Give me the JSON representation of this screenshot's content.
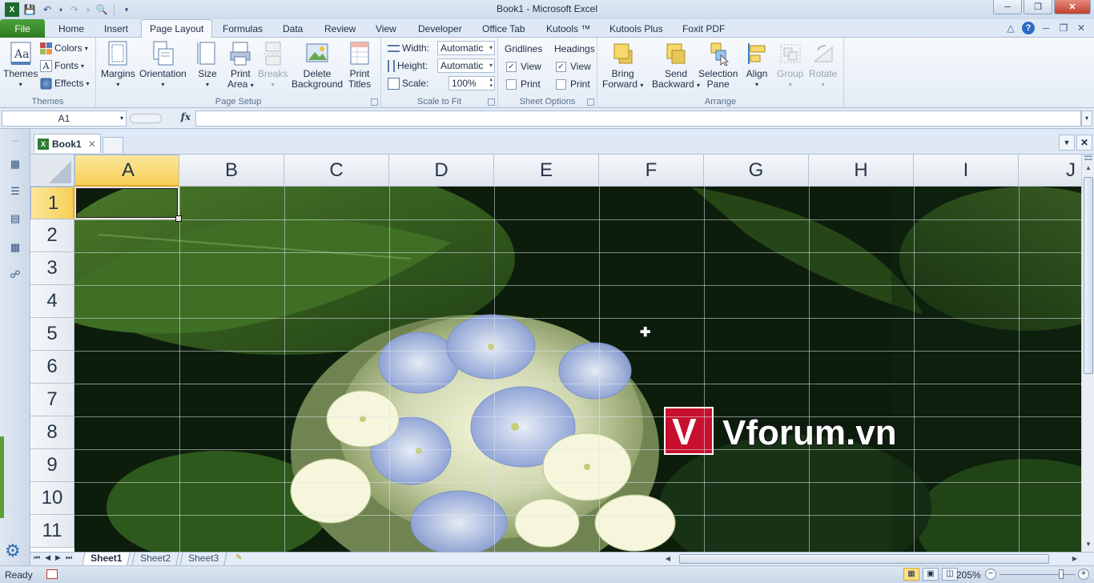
{
  "window": {
    "title": "Book1 - Microsoft Excel"
  },
  "qat": {
    "icons": [
      "save-icon",
      "undo-icon",
      "redo-icon",
      "print-preview-icon",
      "customize-icon"
    ]
  },
  "ribbon_tabs": {
    "file": "File",
    "tabs": [
      "Home",
      "Insert",
      "Page Layout",
      "Formulas",
      "Data",
      "Review",
      "View",
      "Developer",
      "Office Tab",
      "Kutools ™",
      "Kutools Plus",
      "Foxit PDF"
    ],
    "active": "Page Layout"
  },
  "ribbon": {
    "themes": {
      "label": "Themes",
      "themes_btn": "Themes",
      "colors": "Colors",
      "fonts": "Fonts",
      "effects": "Effects"
    },
    "page_setup": {
      "label": "Page Setup",
      "margins": "Margins",
      "orientation": "Orientation",
      "size": "Size",
      "print_area_1": "Print",
      "print_area_2": "Area",
      "breaks": "Breaks",
      "delete_bg_1": "Delete",
      "delete_bg_2": "Background",
      "print_titles_1": "Print",
      "print_titles_2": "Titles"
    },
    "scale_to_fit": {
      "label": "Scale to Fit",
      "width_label": "Width:",
      "width_value": "Automatic",
      "height_label": "Height:",
      "height_value": "Automatic",
      "scale_label": "Scale:",
      "scale_value": "100%"
    },
    "sheet_options": {
      "label": "Sheet Options",
      "gridlines": "Gridlines",
      "headings": "Headings",
      "view": "View",
      "print": "Print",
      "gridlines_view": true,
      "gridlines_print": false,
      "headings_view": true,
      "headings_print": false
    },
    "arrange": {
      "label": "Arrange",
      "bring_1": "Bring",
      "bring_2": "Forward",
      "send_1": "Send",
      "send_2": "Backward",
      "selection_1": "Selection",
      "selection_2": "Pane",
      "align": "Align",
      "group": "Group",
      "rotate": "Rotate"
    }
  },
  "formula_bar": {
    "name_box": "A1",
    "fx": "fx",
    "formula": ""
  },
  "doc_tabs": {
    "active": "Book1"
  },
  "grid": {
    "columns": [
      "A",
      "B",
      "C",
      "D",
      "E",
      "F",
      "G",
      "H",
      "I",
      "J"
    ],
    "rows": [
      "1",
      "2",
      "3",
      "4",
      "5",
      "6",
      "7",
      "8",
      "9",
      "10",
      "11"
    ],
    "active_cell": "A1",
    "background_text": "Vforum.vn",
    "logo_letter": "V"
  },
  "sheets": {
    "tabs": [
      "Sheet1",
      "Sheet2",
      "Sheet3"
    ],
    "active": "Sheet1"
  },
  "status": {
    "ready": "Ready",
    "zoom": "205%",
    "zoom_fraction": 0.82
  },
  "colors": {
    "file_tab": "#2f7b22",
    "selected_header": "#f7cf56",
    "leaf": "#2e5a1f",
    "hydrangea": "#c9d6f2",
    "logo_red": "#c8102e"
  }
}
